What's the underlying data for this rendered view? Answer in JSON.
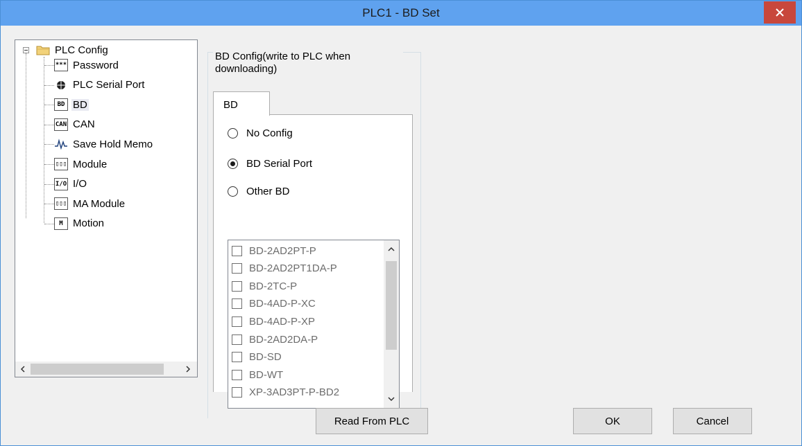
{
  "window": {
    "title": "PLC1 - BD  Set"
  },
  "tree": {
    "items": [
      {
        "label": "PLC Config",
        "icon": "folder-icon",
        "glyph": ""
      },
      {
        "label": "Password",
        "icon": "password-icon",
        "glyph": "***"
      },
      {
        "label": "PLC Serial Port",
        "icon": "serial-port-icon",
        "glyph": "⊕"
      },
      {
        "label": "BD",
        "icon": "bd-icon",
        "glyph": "BD"
      },
      {
        "label": "CAN",
        "icon": "can-icon",
        "glyph": "CAN"
      },
      {
        "label": "Save Hold Memo",
        "icon": "waveform-icon",
        "glyph": ""
      },
      {
        "label": "Module",
        "icon": "module-icon",
        "glyph": "▯▯▯"
      },
      {
        "label": "I/O",
        "icon": "io-icon",
        "glyph": "I/O"
      },
      {
        "label": "MA Module",
        "icon": "ma-module-icon",
        "glyph": "▯▯▯"
      },
      {
        "label": "Motion",
        "icon": "motion-icon",
        "glyph": "M"
      }
    ]
  },
  "bd_config": {
    "group_title": "BD Config(write to PLC when downloading)",
    "tab_label": "BD",
    "options": [
      {
        "label": "No Config",
        "selected": false
      },
      {
        "label": "BD Serial Port",
        "selected": true
      },
      {
        "label": "Other BD",
        "selected": false
      }
    ],
    "boards": [
      "BD-2AD2PT-P",
      "BD-2AD2PT1DA-P",
      "BD-2TC-P",
      "BD-4AD-P-XC",
      "BD-4AD-P-XP",
      "BD-2AD2DA-P",
      "BD-SD",
      "BD-WT",
      "XP-3AD3PT-P-BD2"
    ]
  },
  "buttons": {
    "read": "Read From PLC",
    "ok": "OK",
    "cancel": "Cancel"
  },
  "colors": {
    "titlebar": "#5fa2ef",
    "close": "#c8473c",
    "selection": "#e9eaf2"
  }
}
